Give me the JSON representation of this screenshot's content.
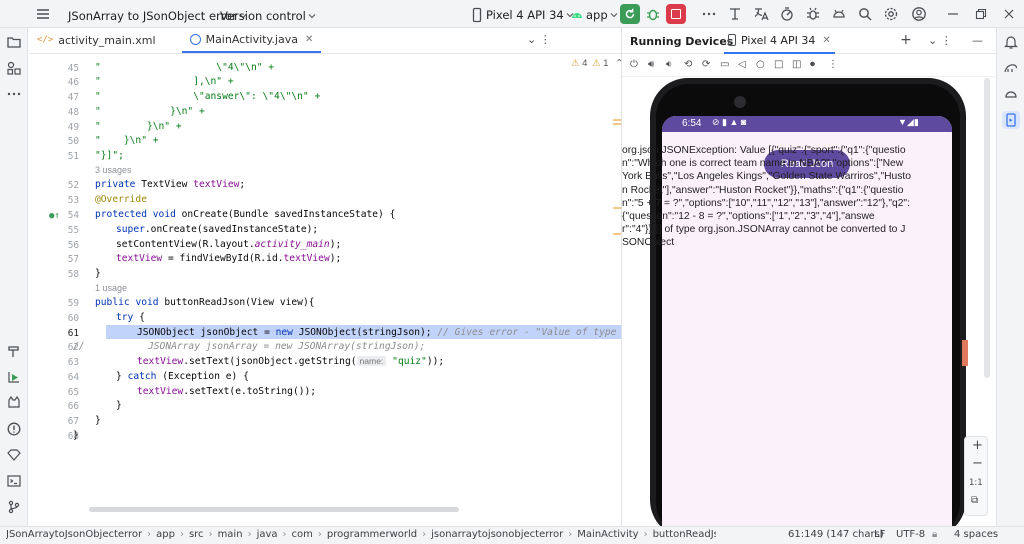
{
  "titlebar": {
    "project": "JSonArray to JSonObject error",
    "vcs": "Version control",
    "device": "Pixel 4 API 34",
    "run_config": "app"
  },
  "editor": {
    "tabs": [
      {
        "label": "activity_main.xml"
      },
      {
        "label": "MainActivity.java"
      }
    ],
    "inspection": {
      "warnings": "4",
      "weak_warnings": "1"
    },
    "usages": [
      "3 usages",
      "1 usage"
    ],
    "param_hint": "name:",
    "line_numbers": [
      "45",
      "46",
      "47",
      "48",
      "49",
      "50",
      "51",
      "52",
      "53",
      "54",
      "55",
      "56",
      "57",
      "58",
      "59",
      "60",
      "61",
      "62",
      "63",
      "64",
      "65",
      "66",
      "67",
      "68"
    ],
    "lines": [
      "\"                    \\\"4\\\"\\n\" +",
      "\"                ],\\n\" +",
      "\"                \\\"answer\\\": \\\"4\\\"\\n\" +",
      "\"            }\\n\" +",
      "\"        }\\n\" +",
      "\"    }\\n\" +",
      "\"}]\";",
      "private TextView textView;",
      "@Override",
      "protected void onCreate(Bundle savedInstanceState) {",
      "super.onCreate(savedInstanceState);",
      "setContentView(R.layout.activity_main);",
      "textView = findViewById(R.id.textView);",
      "}",
      "public void buttonReadJson(View view){",
      "try {",
      "JSONObject jsonObject = new JSONObject(stringJson); // Gives error - \"Value of type org.json",
      "JSONArray jsonArray = new JSONArray(stringJson);",
      "textView.setText(jsonObject.getString( \"quiz\"));",
      "} catch (Exception e) {",
      "textView.setText(e.toString());",
      "}",
      "}",
      "}"
    ],
    "comment_prefix": "//"
  },
  "device_panel": {
    "title": "Running Devices",
    "tab_label": "Pixel 4 API 34",
    "zoom_label": "1:1"
  },
  "phone": {
    "time": "6:54",
    "button_label": "Read Json",
    "output_text": "org.json.JSONException: Value [{\"quiz\":{\"sport\":{\"q1\":{\"question\":\"Which one is correct team name in NBA?\",\"options\":[\"New York Bulls\",\"Los Angeles Kings\",\"Golden State Warriros\",\"Huston Rocket\"],\"answer\":\"Huston Rocket\"}},\"maths\":{\"q1\":{\"question\":\"5 + 7 = ?\",\"options\":[\"10\",\"11\",\"12\",\"13\"],\"answer\":\"12\"},\"q2\":{\"question\":\"12 - 8 = ?\",\"options\":[\"1\",\"2\",\"3\",\"4\"],\"answer\":\"4\"}}}}] of type org.json.JSONArray cannot be converted to JSONObject",
    "accent": "#5e4a9e",
    "screen_bg": "#fbf1fb"
  },
  "statusbar": {
    "breadcrumbs": [
      "JSonArraytoJsonObjecterror",
      "app",
      "src",
      "main",
      "java",
      "com",
      "programmerworld",
      "jsonarraytojsonobjecterror",
      "MainActivity",
      "buttonReadJson"
    ],
    "position": "61:149 (147 chars)",
    "line_sep": "LF",
    "encoding": "UTF-8",
    "indent": "4 spaces"
  }
}
